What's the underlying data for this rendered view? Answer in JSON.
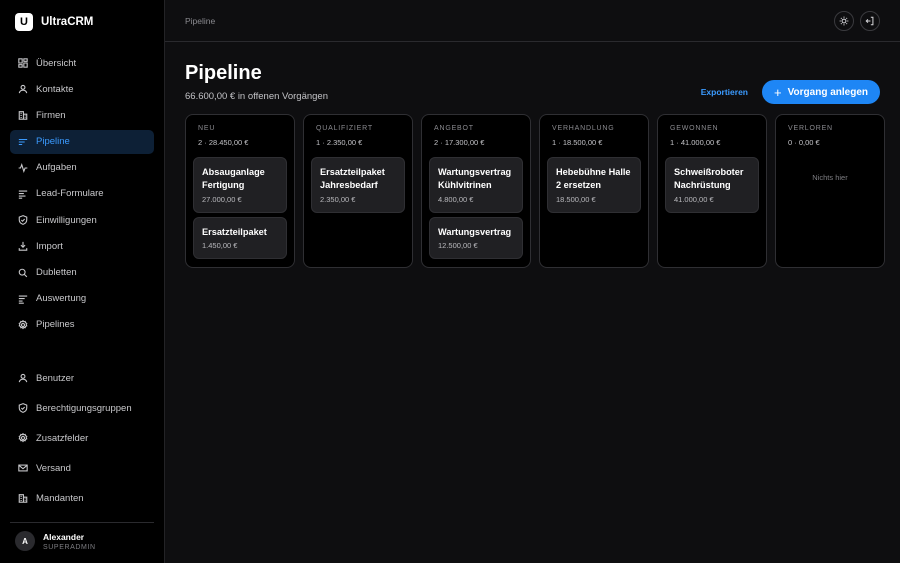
{
  "brand": {
    "logo": "U",
    "name": "UltraCRM"
  },
  "nav_main": [
    {
      "label": "Übersicht",
      "icon": "dashboard-icon"
    },
    {
      "label": "Kontakte",
      "icon": "user-icon"
    },
    {
      "label": "Firmen",
      "icon": "building-icon"
    },
    {
      "label": "Pipeline",
      "icon": "pipeline-icon",
      "active": true
    },
    {
      "label": "Aufgaben",
      "icon": "activity-icon"
    },
    {
      "label": "Lead-Formulare",
      "icon": "form-icon"
    },
    {
      "label": "Einwilligungen",
      "icon": "shield-check-icon"
    },
    {
      "label": "Import",
      "icon": "import-icon"
    },
    {
      "label": "Dubletten",
      "icon": "search-icon"
    },
    {
      "label": "Auswertung",
      "icon": "report-icon"
    },
    {
      "label": "Pipelines",
      "icon": "gear-icon"
    }
  ],
  "nav_admin": [
    {
      "label": "Benutzer",
      "icon": "user-icon"
    },
    {
      "label": "Berechtigungsgruppen",
      "icon": "shield-check-icon"
    },
    {
      "label": "Zusatzfelder",
      "icon": "gear-icon"
    },
    {
      "label": "Versand",
      "icon": "mail-icon"
    },
    {
      "label": "Mandanten",
      "icon": "building-icon"
    }
  ],
  "user": {
    "initial": "A",
    "name": "Alexander",
    "role": "SUPERADMIN"
  },
  "topbar": {
    "breadcrumb": "Pipeline"
  },
  "page": {
    "title": "Pipeline",
    "subtitle": "66.600,00 € in offenen Vorgängen",
    "export_label": "Exportieren",
    "create_label": "Vorgang anlegen"
  },
  "columns": [
    {
      "title": "NEU",
      "stats": "2 · 28.450,00 €",
      "cards": [
        {
          "title": "Absauganlage Fertigung",
          "value": "27.000,00 €"
        },
        {
          "title": "Ersatzteilpaket",
          "value": "1.450,00 €"
        }
      ]
    },
    {
      "title": "QUALIFIZIERT",
      "stats": "1 · 2.350,00 €",
      "cards": [
        {
          "title": "Ersatzteilpaket Jahresbedarf",
          "value": "2.350,00 €"
        }
      ]
    },
    {
      "title": "ANGEBOT",
      "stats": "2 · 17.300,00 €",
      "cards": [
        {
          "title": "Wartungsvertrag Kühlvitrinen",
          "value": "4.800,00 €"
        },
        {
          "title": "Wartungsvertrag",
          "value": "12.500,00 €"
        }
      ]
    },
    {
      "title": "VERHANDLUNG",
      "stats": "1 · 18.500,00 €",
      "cards": [
        {
          "title": "Hebebühne Halle 2 ersetzen",
          "value": "18.500,00 €"
        }
      ]
    },
    {
      "title": "GEWONNEN",
      "stats": "1 · 41.000,00 €",
      "cards": [
        {
          "title": "Schweißroboter Nachrüstung",
          "value": "41.000,00 €"
        }
      ]
    },
    {
      "title": "VERLOREN",
      "stats": "0 · 0,00 €",
      "cards": [],
      "empty": "Nichts hier"
    }
  ]
}
